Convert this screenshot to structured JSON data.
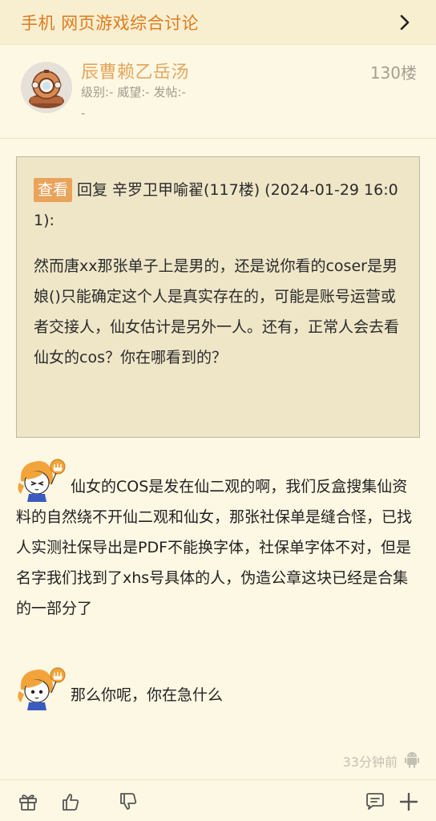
{
  "header": {
    "title": "手机 网页游戏综合讨论",
    "chevron_icon": "chevron-right-icon"
  },
  "user": {
    "name": "辰曹赖乙岳汤",
    "stats_line1": "级别:- 威望:- 发帖:-",
    "stats_line2": "-",
    "floor": "130楼",
    "avatar_icon": "diving-helmet-avatar"
  },
  "quote": {
    "tag": "查看",
    "header_text": "回复 辛罗卫甲喻翟(117楼) (2024-01-29 16:01):",
    "body": "然而唐xx那张单子上是男的，还是说你看的coser是男娘()只能确定这个人是真实存在的，可能是账号运营或者交接人，仙女估计是另外一人。还有，正常人会去看仙女的cos？你在哪看到的？"
  },
  "post": {
    "paragraph1": "仙女的COS是发在仙二观的啊，我们反盒搜集仙资料的自然绕不开仙二观和仙女，那张社保单是缝合怪，已找人实测社保导出是PDF不能换字体，社保单字体不对，但是名字我们找到了xhs号具体的人，伪造公章这块已经是合集的一部分了",
    "paragraph2": "那么你呢，你在急什么",
    "sticker_icon": "anime-girl-sticker"
  },
  "meta": {
    "time": "33分钟前",
    "device_icon": "android-icon"
  },
  "actions": {
    "gift_icon": "gift-icon",
    "like_icon": "thumbs-up-icon",
    "dislike_icon": "thumbs-down-icon",
    "reply_icon": "comment-icon",
    "more_icon": "plus-icon"
  },
  "colors": {
    "background": "#fdf8e4",
    "header_bg": "#f7efcf",
    "accent_orange": "#e07a1f",
    "username": "#e4a65f",
    "quote_bg": "#efe6c8",
    "tag_bg": "#e9a35a"
  }
}
